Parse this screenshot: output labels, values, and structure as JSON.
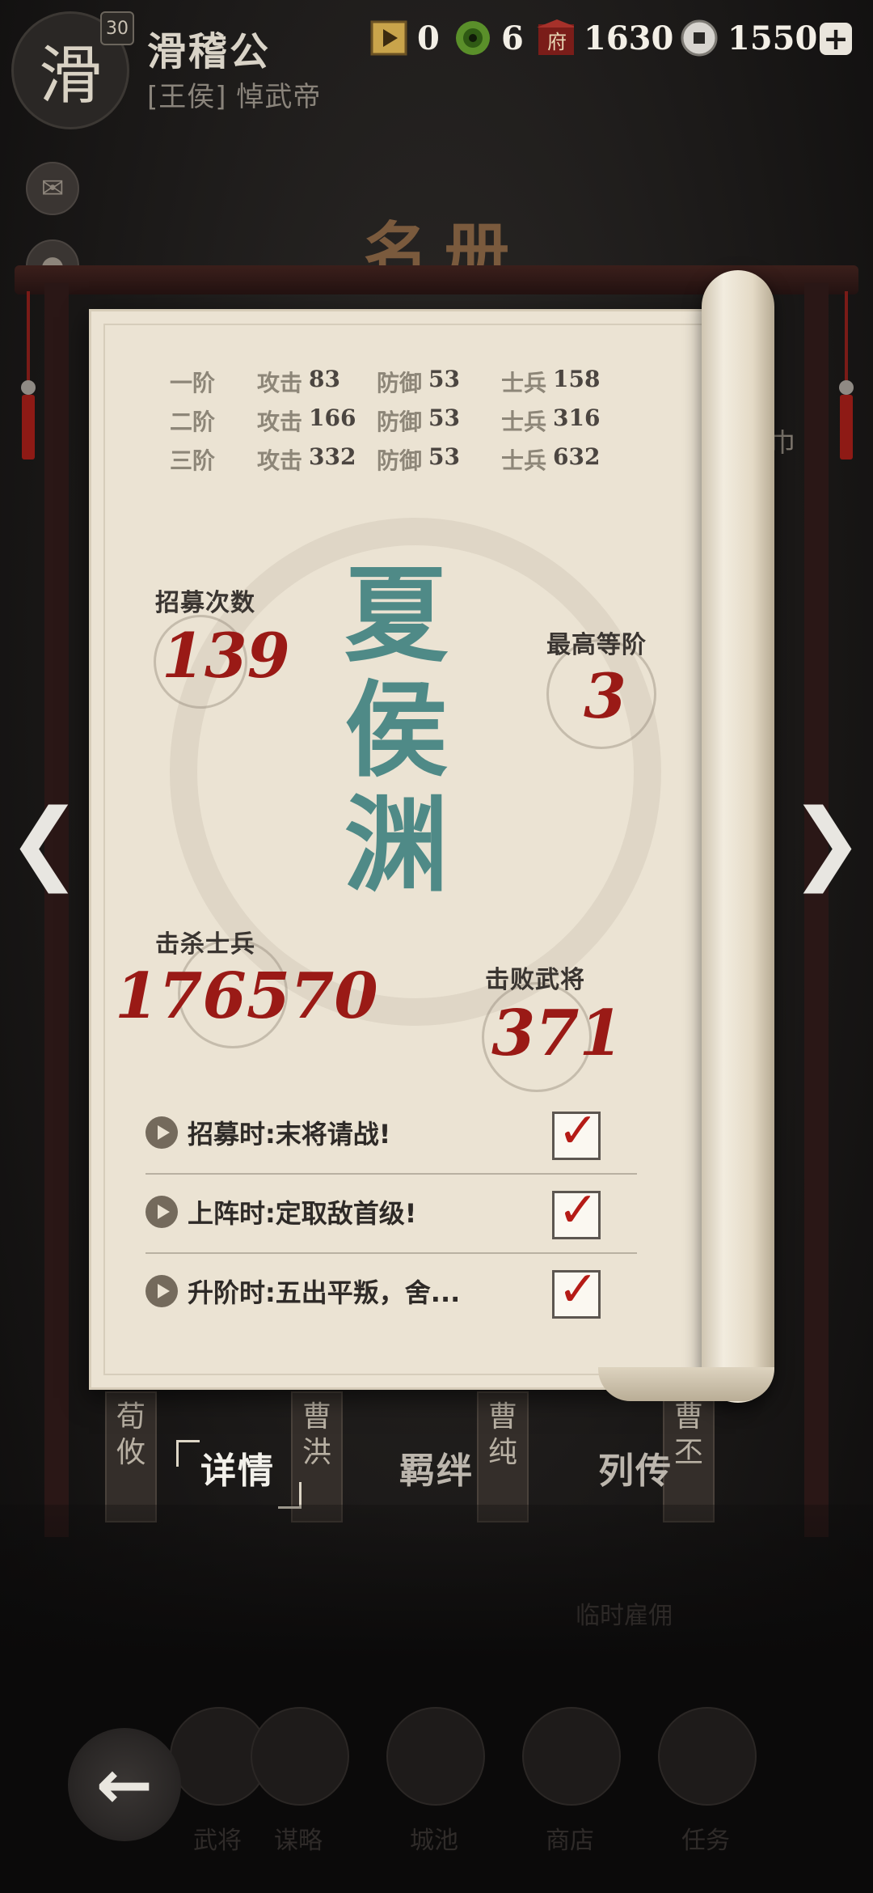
{
  "player": {
    "avatar_char": "滑",
    "level": "30",
    "name": "滑稽公",
    "title": "[王侯] 悼武帝"
  },
  "resources": [
    {
      "icon": "video-ticket-icon",
      "value": "0"
    },
    {
      "icon": "jade-eye-icon",
      "value": "6"
    },
    {
      "icon": "government-building-icon",
      "value": "1630"
    },
    {
      "icon": "coin-icon",
      "value": "1550"
    }
  ],
  "roster_title": "名册",
  "background": {
    "edge_text": "巾",
    "cards": [
      "荀攸",
      "曹洪",
      "曹纯",
      "曹丕"
    ]
  },
  "tiers": [
    {
      "tier": "一阶",
      "atk_label": "攻击",
      "atk": "83",
      "def_label": "防御",
      "def": "53",
      "sol_label": "士兵",
      "sol": "158"
    },
    {
      "tier": "二阶",
      "atk_label": "攻击",
      "atk": "166",
      "def_label": "防御",
      "def": "53",
      "sol_label": "士兵",
      "sol": "316"
    },
    {
      "tier": "三阶",
      "atk_label": "攻击",
      "atk": "332",
      "def_label": "防御",
      "def": "53",
      "sol_label": "士兵",
      "sol": "632"
    }
  ],
  "hero": {
    "name_chars": [
      "夏",
      "侯",
      "渊"
    ],
    "recruit_label": "招募次数",
    "recruit_value": "139",
    "max_tier_label": "最高等阶",
    "max_tier_value": "3",
    "kills_label": "击杀士兵",
    "kills_value": "176570",
    "defeated_label": "击败武将",
    "defeated_value": "371"
  },
  "voices": [
    {
      "text": "招募时:末将请战!",
      "checked": true
    },
    {
      "text": "上阵时:定取敌首级!",
      "checked": true
    },
    {
      "text": "升阶时:五出平叛，舍...",
      "checked": true
    }
  ],
  "tabs": [
    "详情",
    "羁绊",
    "列传"
  ],
  "active_tab": "详情",
  "bottom": {
    "faded_label": "临时雇佣"
  },
  "dock": [
    "武将",
    "谋略",
    "城池",
    "商店",
    "任务"
  ],
  "colors": {
    "accent_red": "#9a1a16",
    "hero_teal": "#4f8a87",
    "paper": "#ebe3d3"
  }
}
